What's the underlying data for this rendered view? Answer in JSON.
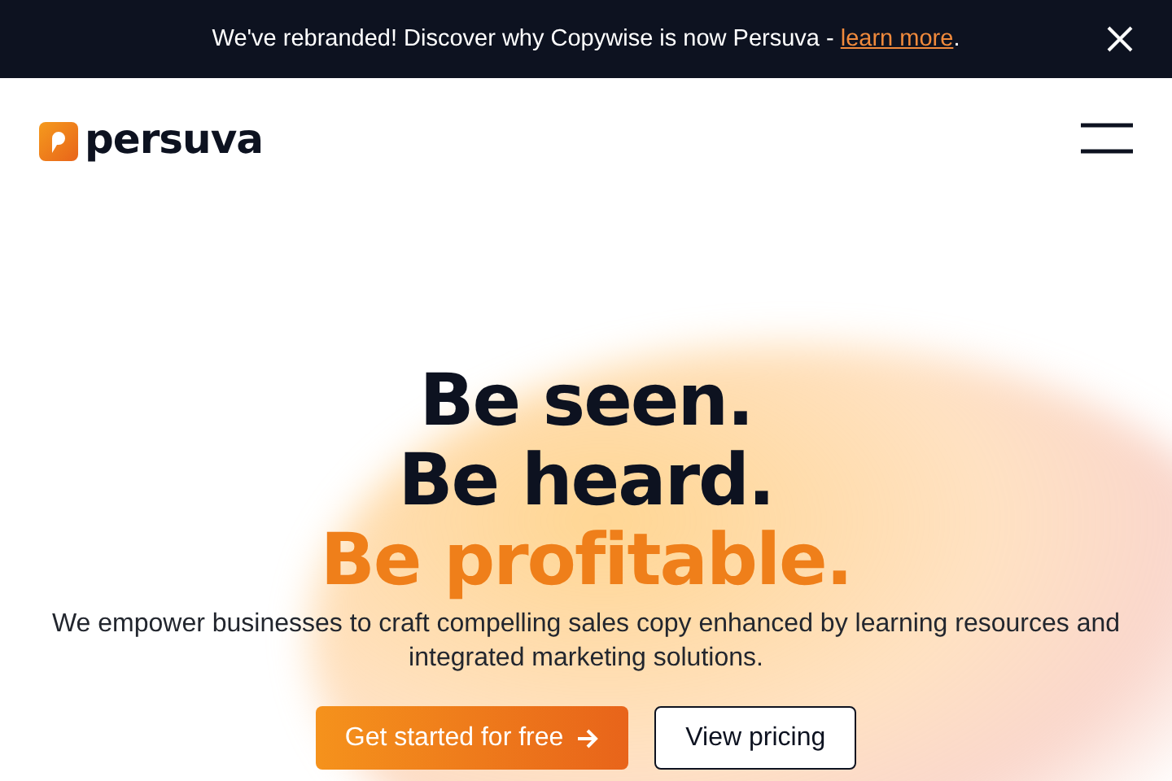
{
  "banner": {
    "text": "We've rebranded! Discover why Copywise is now Persuva - ",
    "link": "learn more",
    "after": "."
  },
  "header": {
    "logo": "persuva"
  },
  "hero": {
    "lines": [
      {
        "text": "Be seen.",
        "accent": false
      },
      {
        "text": "Be heard.",
        "accent": false
      },
      {
        "text": "Be profitable.",
        "accent": true
      }
    ],
    "subtitle": "We empower businesses to craft compelling sales copy enhanced by learning resources and integrated marketing solutions.",
    "buttons": [
      {
        "label": "Get started for free",
        "kind": "primary"
      },
      {
        "label": "View pricing",
        "kind": "secondary"
      }
    ]
  }
}
